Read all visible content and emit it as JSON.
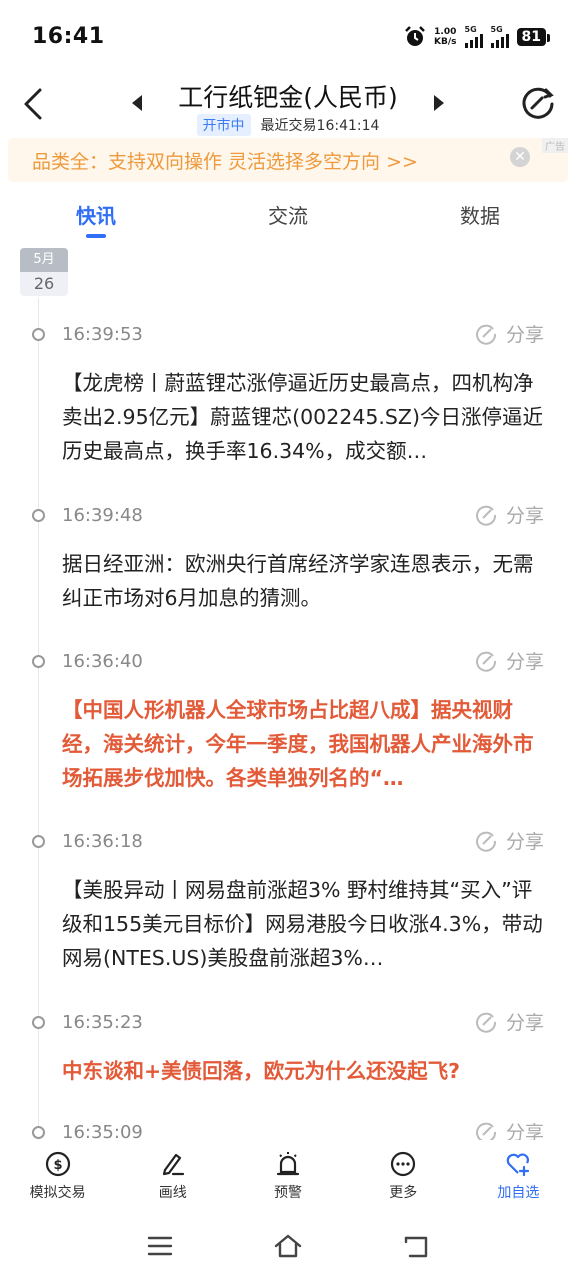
{
  "status_bar": {
    "time": "16:41",
    "net_speed_value": "1.00",
    "net_speed_unit": "KB/s",
    "sim1": "5G",
    "sim2": "5G",
    "battery": "81"
  },
  "header": {
    "title": "工行纸钯金(人民币)",
    "market_status": "开市中",
    "last_trade": "最近交易16:41:14"
  },
  "ad": {
    "text": "品类全：支持双向操作 灵活选择多空方向 >>",
    "close": "✕",
    "tag": "广告"
  },
  "tabs": [
    {
      "label": "快讯",
      "active": true
    },
    {
      "label": "交流",
      "active": false
    },
    {
      "label": "数据",
      "active": false
    }
  ],
  "date": {
    "month": "5月",
    "day": "26"
  },
  "share_label": "分享",
  "news": [
    {
      "time": "16:39:53",
      "body": "【龙虎榜丨蔚蓝锂芯涨停逼近历史最高点，四机构净卖出2.95亿元】蔚蓝锂芯(002245.SZ)今日涨停逼近历史最高点，换手率16.34%，成交额…",
      "highlight": false
    },
    {
      "time": "16:39:48",
      "body": "据日经亚洲：欧洲央行首席经济学家连恩表示，无需纠正市场对6月加息的猜测。",
      "highlight": false
    },
    {
      "time": "16:36:40",
      "body": "【中国人形机器人全球市场占比超八成】据央视财经，海关统计，今年一季度，我国机器人产业海外市场拓展步伐加快。各类单独列名的“…",
      "highlight": true
    },
    {
      "time": "16:36:18",
      "body": "【美股异动丨网易盘前涨超3% 野村维持其“买入”评级和155美元目标价】网易港股今日收涨4.3%，带动网易(NTES.US)美股盘前涨超3%…",
      "highlight": false
    },
    {
      "time": "16:35:23",
      "body": "中东谈和+美债回落，欧元为什么还没起飞?",
      "highlight": true
    },
    {
      "time": "16:35:09",
      "body": "",
      "highlight": false
    }
  ],
  "toolbar": [
    {
      "label": "模拟交易",
      "icon": "simulated-trade-icon"
    },
    {
      "label": "画线",
      "icon": "draw-line-icon"
    },
    {
      "label": "预警",
      "icon": "alarm-bell-icon"
    },
    {
      "label": "更多",
      "icon": "more-icon"
    },
    {
      "label": "加自选",
      "icon": "heart-plus-icon"
    }
  ],
  "colors": {
    "accent": "#2f6ef5",
    "highlight_text": "#e25a38",
    "ad_text": "#ee9a3c",
    "ad_background": "#fff6ec"
  }
}
